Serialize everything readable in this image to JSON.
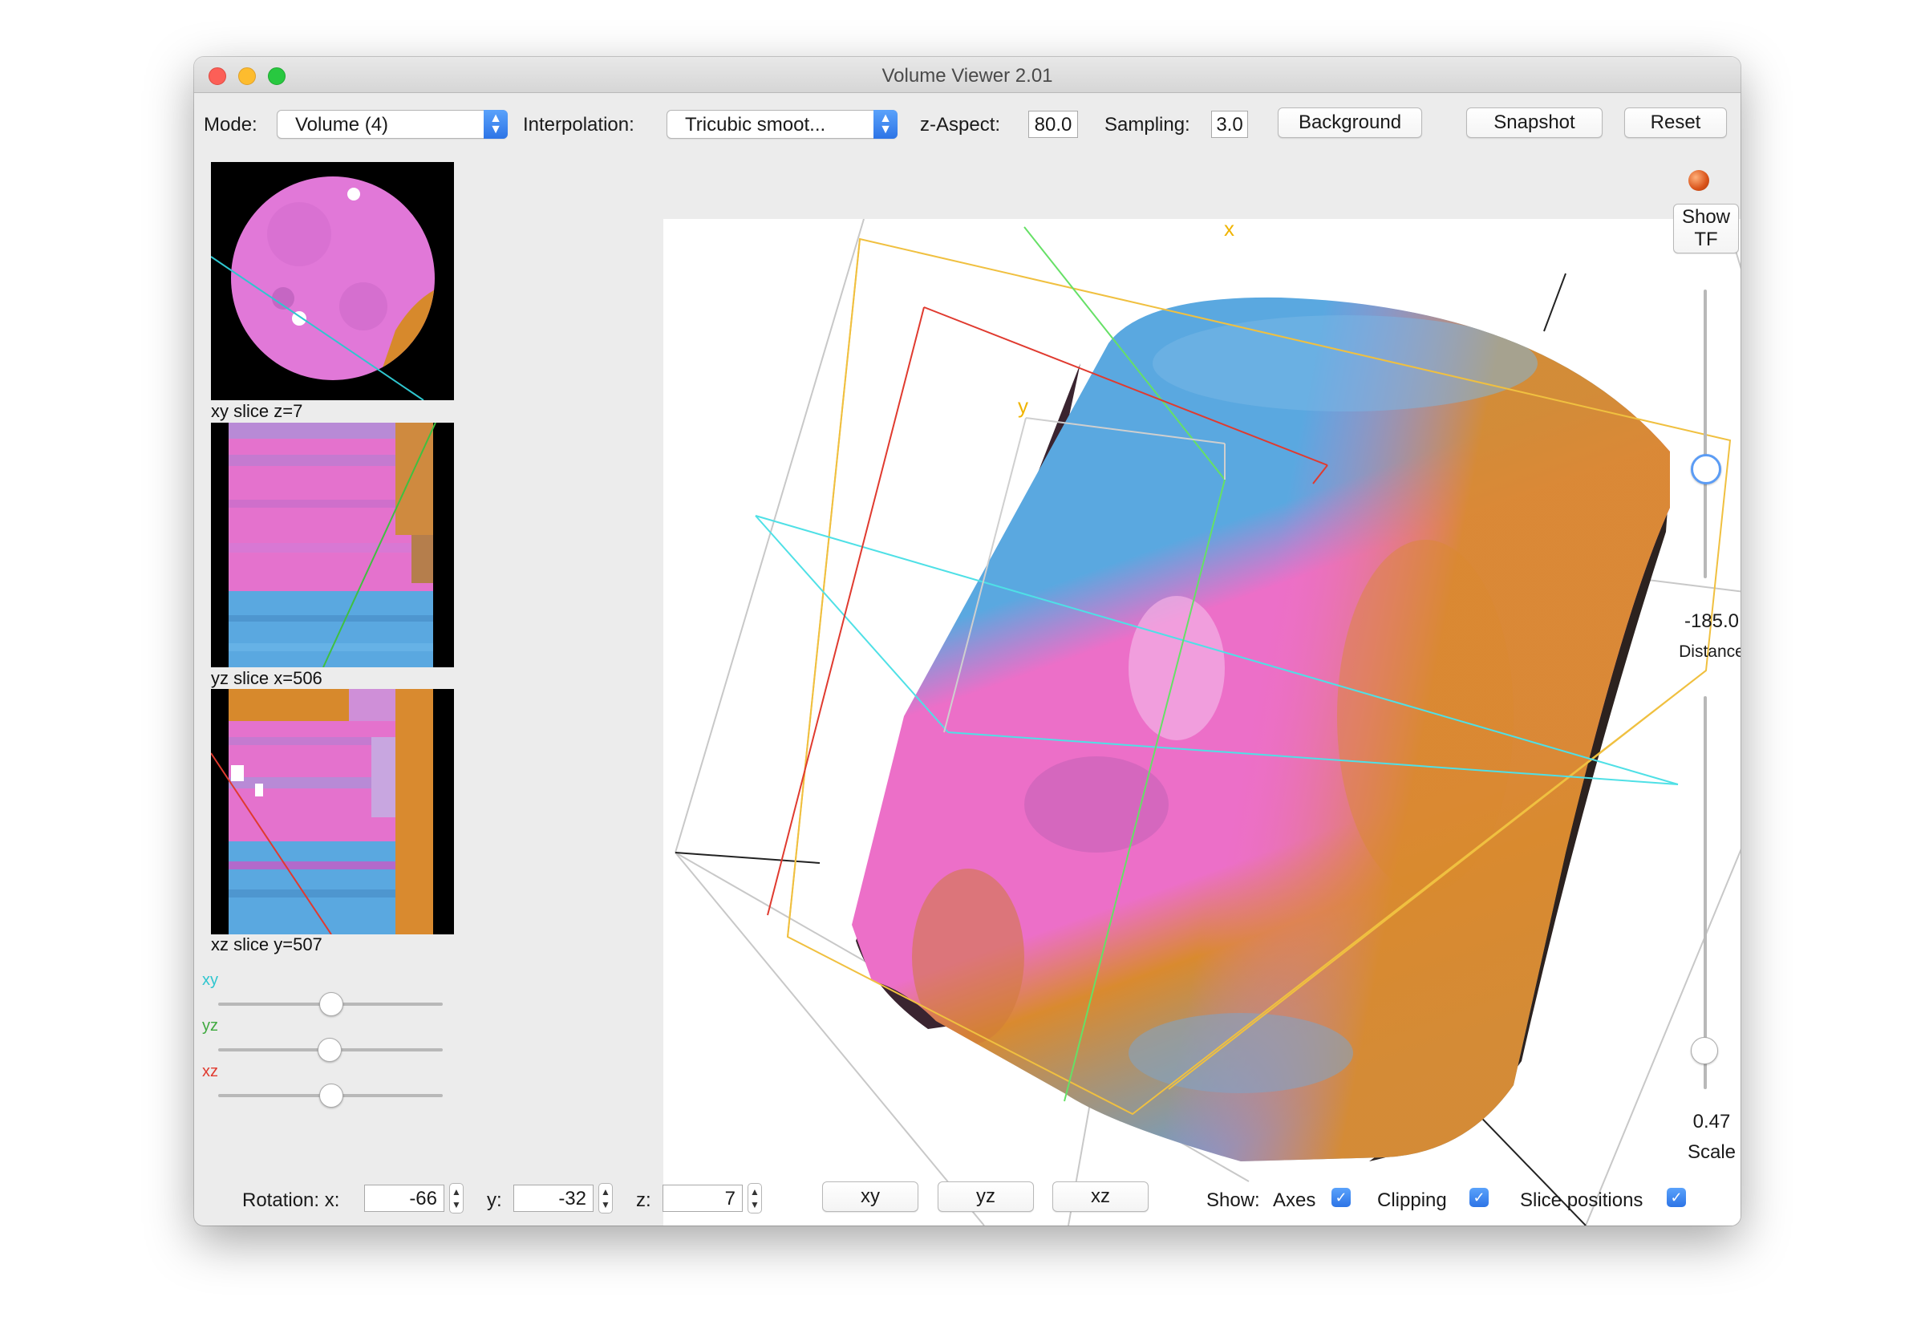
{
  "window": {
    "title": "Volume Viewer 2.01"
  },
  "toolbar": {
    "mode_label": "Mode:",
    "mode_value": "Volume (4)",
    "interpolation_label": "Interpolation:",
    "interpolation_value": "Tricubic smoot...",
    "z_aspect_label": "z-Aspect:",
    "z_aspect_value": "80.0",
    "sampling_label": "Sampling:",
    "sampling_value": "3.0",
    "background_button": "Background",
    "snapshot_button": "Snapshot",
    "reset_button": "Reset"
  },
  "slices": {
    "xy_caption": "xy slice   z=7",
    "yz_caption": "yz slice   x=506",
    "xz_caption": "xz slice   y=507",
    "sliders": [
      {
        "label": "xy",
        "color": "#2fc6cf",
        "level": 0.5
      },
      {
        "label": "yz",
        "color": "#3fa93f",
        "level": 0.5
      },
      {
        "label": "xz",
        "color": "#e03a2f",
        "level": 0.5
      }
    ]
  },
  "right_panel": {
    "show_tf_line1": "Show",
    "show_tf_line2": "TF",
    "distance_value": "-185.0",
    "distance_label": "Distance",
    "scale_value": "0.47",
    "scale_label": "Scale"
  },
  "view": {
    "x_axis_label": "x",
    "y_axis_label": "y",
    "axis_label_color": "#f0b400"
  },
  "bottom": {
    "rotation_label": "Rotation: x:",
    "rot_x": "-66",
    "y_label": "y:",
    "rot_y": "-32",
    "z_label": "z:",
    "rot_z": "7",
    "xy_button": "xy",
    "yz_button": "yz",
    "xz_button": "xz",
    "show_label": "Show:",
    "axes_label": "Axes",
    "clipping_label": "Clipping",
    "slice_positions_label": "Slice positions",
    "axes_checked": true,
    "clipping_checked": true,
    "slice_positions_checked": true
  },
  "colors": {
    "blue": "#5aa8e0",
    "pink": "#ee6fc6",
    "orange": "#d78a2c",
    "accent": "#2d74e6"
  }
}
